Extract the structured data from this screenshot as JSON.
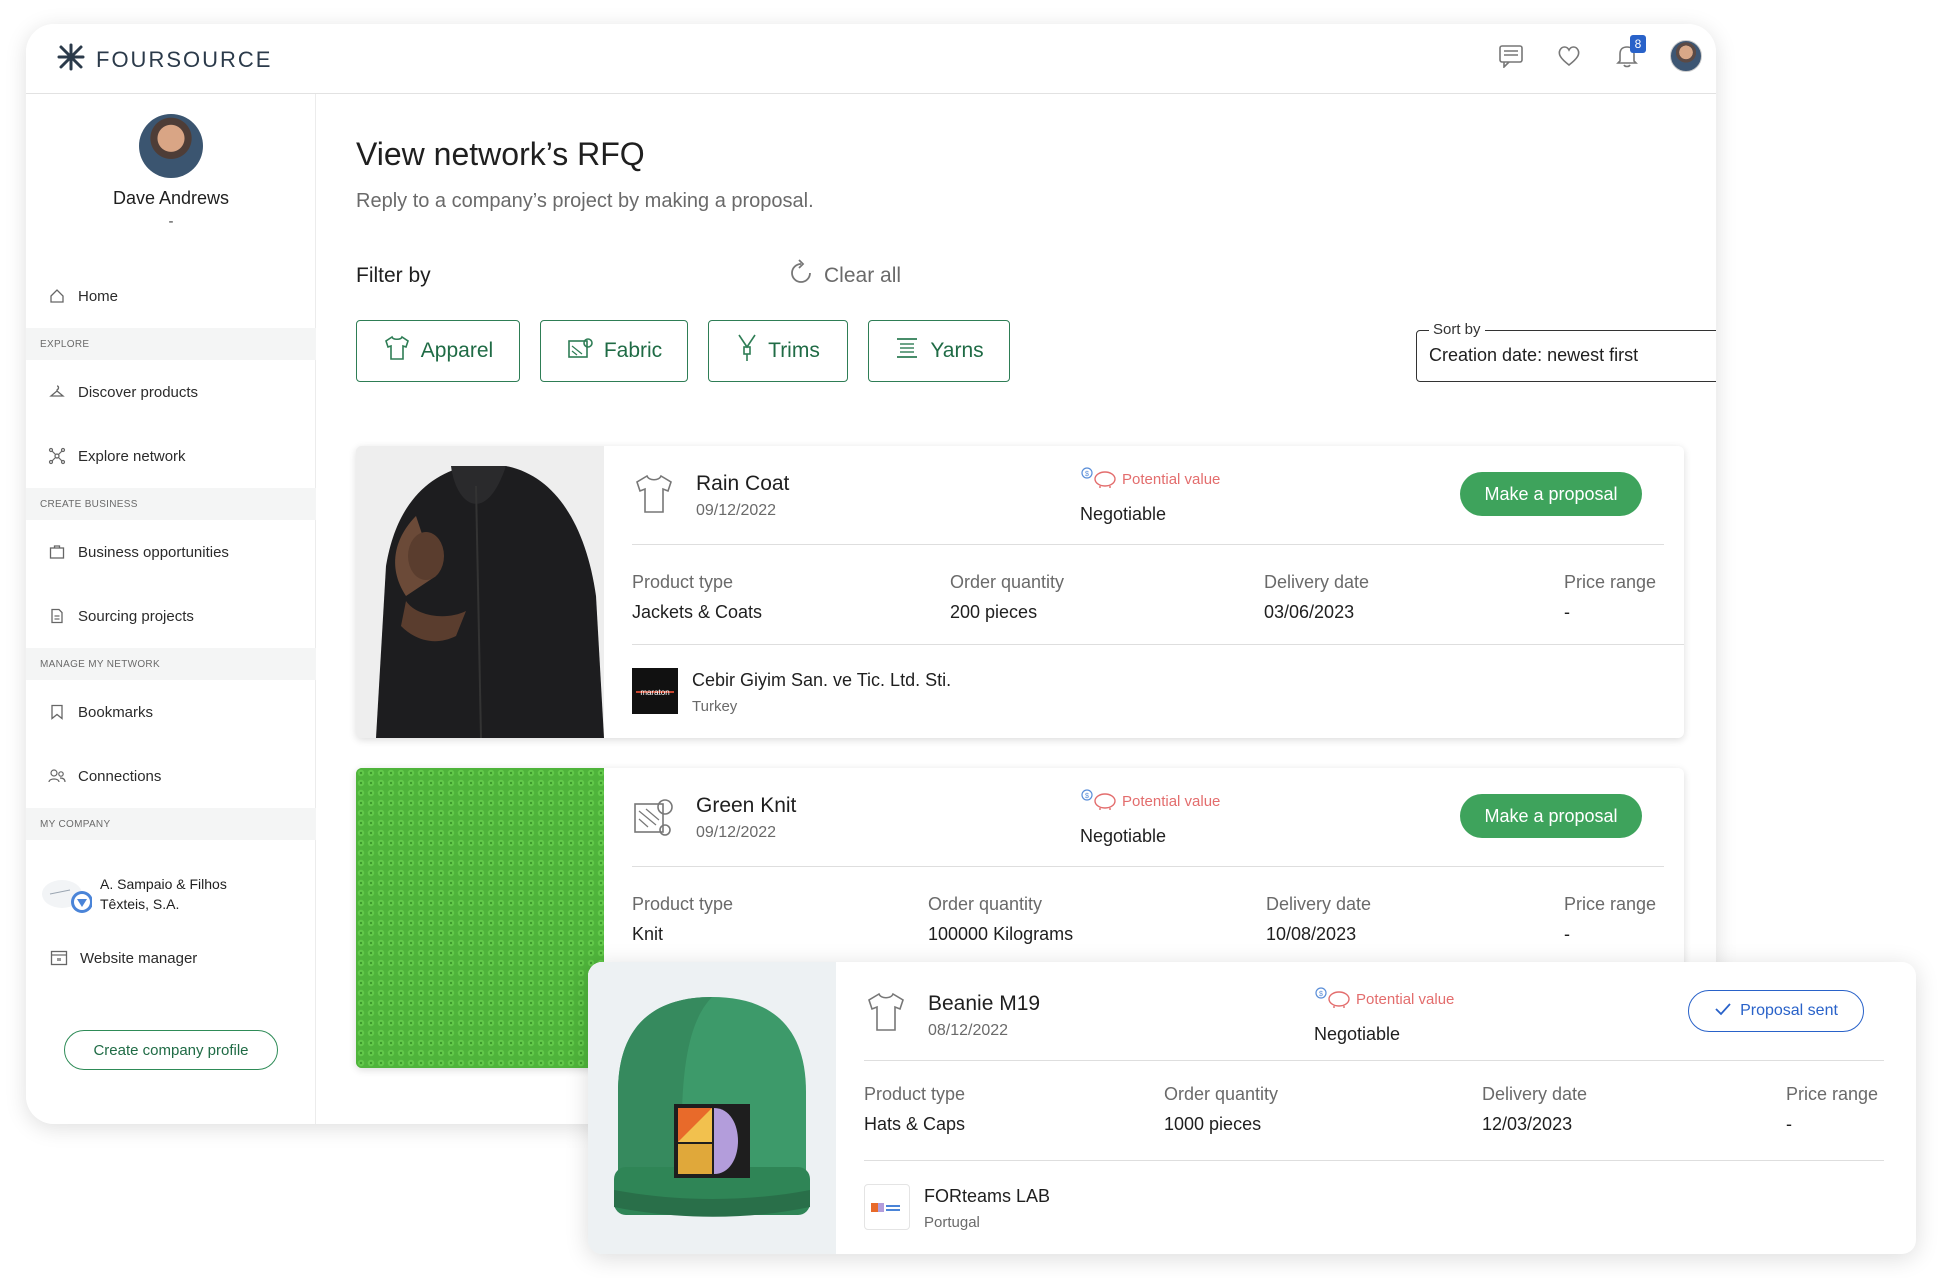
{
  "app": {
    "logo_text": "FOURSOURCE"
  },
  "topbar": {
    "notification_count": "8"
  },
  "profile": {
    "name": "Dave Andrews",
    "subtitle": "-"
  },
  "sidebar": {
    "home": "Home",
    "section_explore": "EXPLORE",
    "discover": "Discover products",
    "explore_network": "Explore network",
    "section_create": "CREATE BUSINESS",
    "business_opps": "Business opportunities",
    "sourcing_projects": "Sourcing projects",
    "section_network": "MANAGE MY NETWORK",
    "bookmarks": "Bookmarks",
    "connections": "Connections",
    "section_company": "MY COMPANY",
    "company_name_1": "A. Sampaio & Filhos",
    "company_name_2": "Têxteis, S.A.",
    "website_manager": "Website manager",
    "create_profile": "Create company profile"
  },
  "main": {
    "title": "View network’s RFQ",
    "subtitle": "Reply to a company’s project by making a proposal.",
    "filter_label": "Filter by",
    "clear_all": "Clear all",
    "chips": [
      "Apparel",
      "Fabric",
      "Trims",
      "Yarns"
    ],
    "sort_label": "Sort by",
    "sort_value": "Creation date: newest first"
  },
  "labels": {
    "potential_value": "Potential value",
    "product_type": "Product type",
    "order_quantity": "Order quantity",
    "delivery_date": "Delivery date",
    "price_range": "Price range",
    "make_proposal": "Make a proposal",
    "proposal_sent": "Proposal sent"
  },
  "rfqs": [
    {
      "name": "Rain Coat",
      "date": "09/12/2022",
      "potential_value": "Negotiable",
      "product_type": "Jackets & Coats",
      "order_quantity": "200 pieces",
      "delivery_date": "03/06/2023",
      "price_range": "-",
      "supplier": "Cebir Giyim San. ve Tic. Ltd. Sti.",
      "country": "Turkey",
      "supplier_logo_text": "maraton"
    },
    {
      "name": "Green Knit",
      "date": "09/12/2022",
      "potential_value": "Negotiable",
      "product_type": "Knit",
      "order_quantity": "100000 Kilograms",
      "delivery_date": "10/08/2023",
      "price_range": "-"
    },
    {
      "name": "Beanie M19",
      "date": "08/12/2022",
      "potential_value": "Negotiable",
      "product_type": "Hats & Caps",
      "order_quantity": "1000 pieces",
      "delivery_date": "12/03/2023",
      "price_range": "-",
      "supplier": "FORteams LAB",
      "country": "Portugal"
    }
  ],
  "colors": {
    "accent_green": "#3ea35c",
    "outline_green": "#2e7d55",
    "potential_red": "#e36d6d",
    "sent_blue": "#2962c9"
  }
}
